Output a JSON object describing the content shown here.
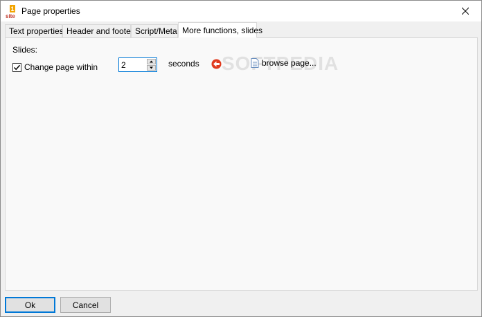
{
  "window": {
    "title": "Page properties"
  },
  "tabs": [
    {
      "label": "Text properties"
    },
    {
      "label": "Header and footer"
    },
    {
      "label": "Script/Meta"
    },
    {
      "label": "More functions, slides"
    }
  ],
  "slides": {
    "section_label": "Slides:",
    "checkbox_label": "Change page within",
    "checked": true,
    "seconds_value": "2",
    "seconds_label": "seconds",
    "browse_label": "browse page..."
  },
  "watermark": "SOFTPEDIA",
  "buttons": {
    "ok": "Ok",
    "cancel": "Cancel"
  }
}
